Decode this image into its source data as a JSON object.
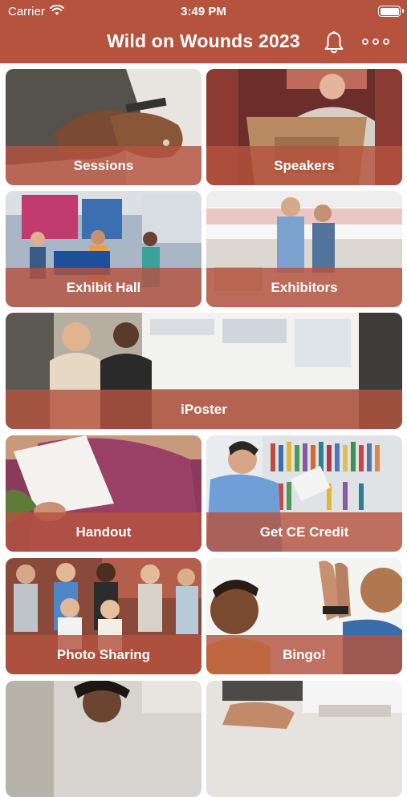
{
  "status_bar": {
    "carrier": "Carrier",
    "time": "3:49 PM"
  },
  "header": {
    "title": "Wild on Wounds  2023",
    "accent_color": "#b5533f"
  },
  "icons": {
    "notifications": "bell-icon",
    "more": "more-horizontal-icon"
  },
  "tiles": [
    {
      "label": "Sessions"
    },
    {
      "label": "Speakers"
    },
    {
      "label": "Exhibit Hall"
    },
    {
      "label": "Exhibitors"
    },
    {
      "label": "iPoster"
    },
    {
      "label": "Handout"
    },
    {
      "label": "Get CE Credit"
    },
    {
      "label": "Photo Sharing"
    },
    {
      "label": "Bingo!"
    }
  ]
}
